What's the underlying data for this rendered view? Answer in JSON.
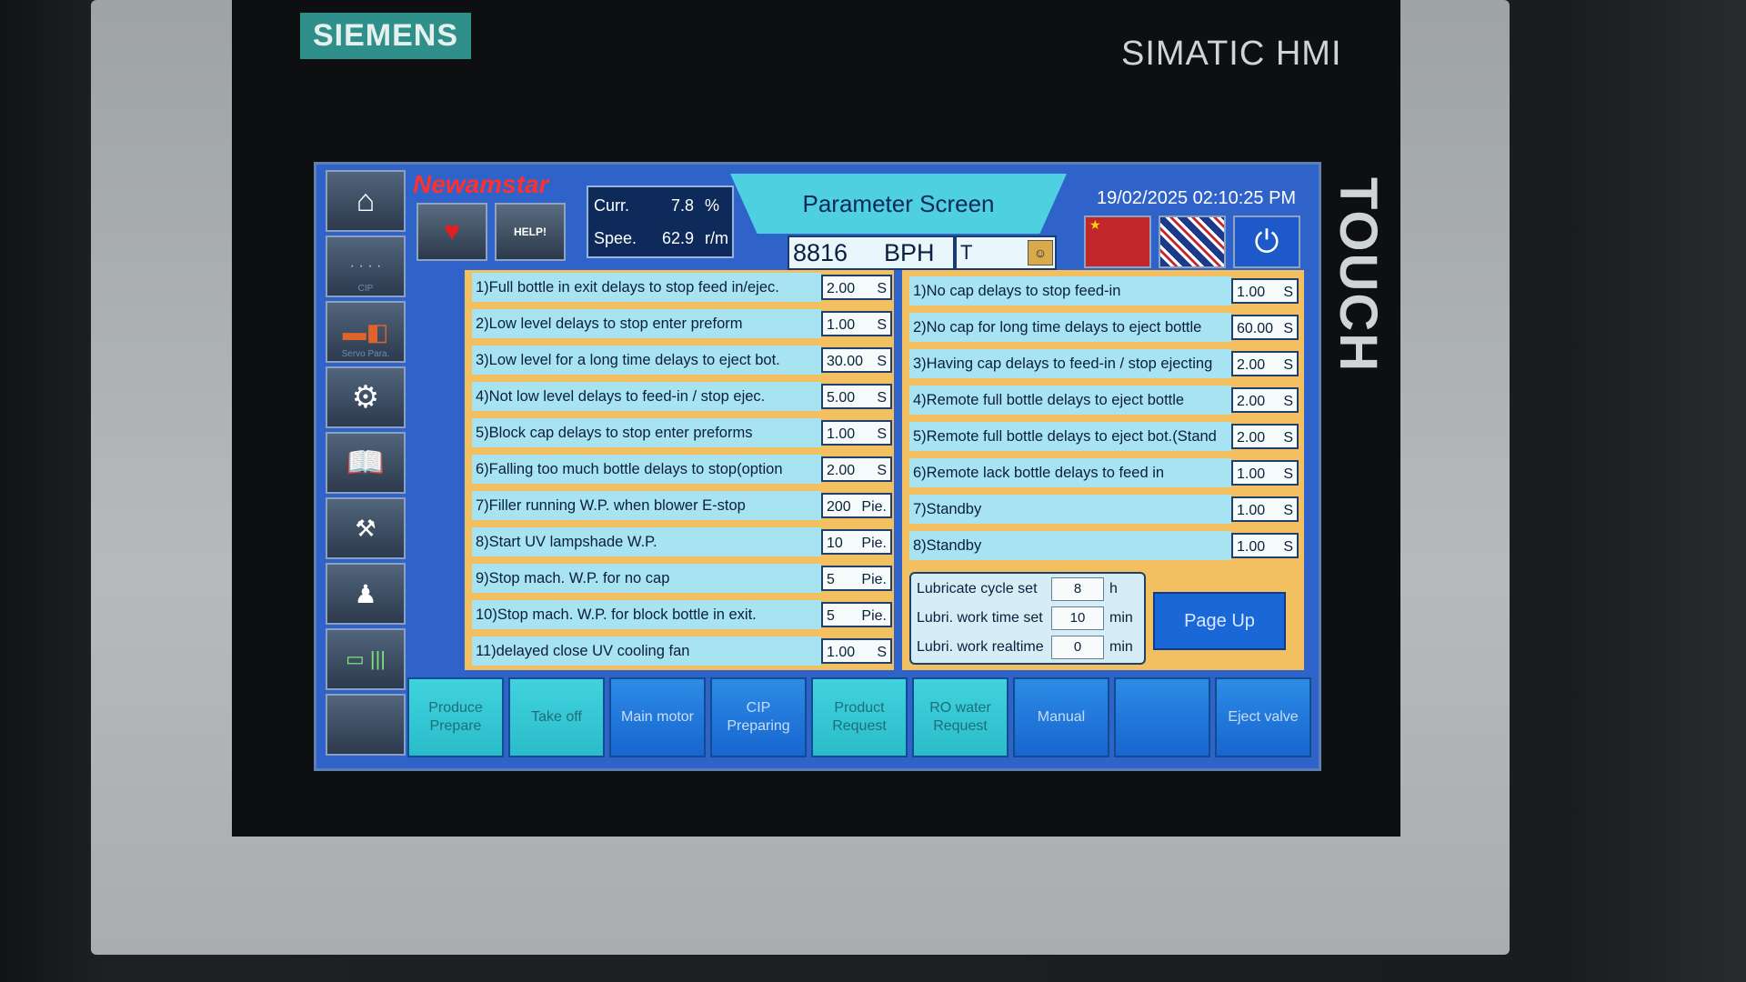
{
  "device": {
    "brand": "SIEMENS",
    "model": "SIMATIC HMI",
    "touch_label": "TOUCH"
  },
  "header": {
    "logo": "Newamstar",
    "help_label": "HELP!",
    "curr_label": "Curr.",
    "curr_value": "7.8",
    "curr_unit": "%",
    "speed_label": "Spee.",
    "speed_value": "62.9",
    "speed_unit": "r/m",
    "title": "Parameter Screen",
    "bph_value": "8816",
    "bph_unit": "BPH",
    "t_field": "T",
    "datetime": "19/02/2025 02:10:25 PM"
  },
  "sidebar": {
    "cip_caption": "CIP",
    "servo_caption": "Servo Para."
  },
  "left_params": [
    {
      "label": "1)Full bottle in exit delays to stop feed in/ejec.",
      "value": "2.00",
      "unit": "S"
    },
    {
      "label": "2)Low level delays to stop enter preform",
      "value": "1.00",
      "unit": "S"
    },
    {
      "label": "3)Low level for a long time delays to eject bot.",
      "value": "30.00",
      "unit": "S"
    },
    {
      "label": "4)Not low level delays to feed-in / stop ejec.",
      "value": "5.00",
      "unit": "S"
    },
    {
      "label": "5)Block cap delays to stop enter preforms",
      "value": "1.00",
      "unit": "S"
    },
    {
      "label": "6)Falling too much bottle delays to stop(option",
      "value": "2.00",
      "unit": "S"
    },
    {
      "label": "7)Filler running W.P. when blower E-stop",
      "value": "200",
      "unit": "Pie."
    },
    {
      "label": "8)Start UV lampshade W.P.",
      "value": "10",
      "unit": "Pie."
    },
    {
      "label": "9)Stop mach.  W.P. for no cap",
      "value": "5",
      "unit": "Pie."
    },
    {
      "label": "10)Stop mach. W.P. for block bottle in exit.",
      "value": "5",
      "unit": "Pie."
    },
    {
      "label": "11)delayed close UV cooling fan",
      "value": "1.00",
      "unit": "S"
    }
  ],
  "right_params": [
    {
      "label": "1)No cap delays to stop feed-in",
      "value": "1.00",
      "unit": "S"
    },
    {
      "label": "2)No cap for long time  delays to eject bottle",
      "value": "60.00",
      "unit": "S"
    },
    {
      "label": "3)Having cap delays to feed-in / stop ejecting",
      "value": "2.00",
      "unit": "S"
    },
    {
      "label": "4)Remote full bottle delays to eject bottle",
      "value": "2.00",
      "unit": "S"
    },
    {
      "label": "5)Remote full bottle delays to eject bot.(Stand",
      "value": "2.00",
      "unit": "S"
    },
    {
      "label": "6)Remote lack bottle delays to feed in",
      "value": "1.00",
      "unit": "S"
    },
    {
      "label": "7)Standby",
      "value": "1.00",
      "unit": "S"
    },
    {
      "label": "8)Standby",
      "value": "1.00",
      "unit": "S"
    }
  ],
  "lubrication": {
    "rows": [
      {
        "label": "Lubricate cycle set",
        "value": "8",
        "unit": "h"
      },
      {
        "label": "Lubri. work time set",
        "value": "10",
        "unit": "min"
      },
      {
        "label": "Lubri. work realtime",
        "value": "0",
        "unit": "min"
      }
    ]
  },
  "page_up_label": "Page Up",
  "bottom_buttons": [
    {
      "label": "Produce\nPrepare",
      "style": "cyan"
    },
    {
      "label": "Take off",
      "style": "cyan"
    },
    {
      "label": "Main motor",
      "style": "blue"
    },
    {
      "label": "CIP\nPreparing",
      "style": "blue"
    },
    {
      "label": "Product\nRequest",
      "style": "cyan"
    },
    {
      "label": "RO water\nRequest",
      "style": "cyan"
    },
    {
      "label": "Manual",
      "style": "blue"
    },
    {
      "label": "",
      "style": "blue"
    },
    {
      "label": "Eject valve",
      "style": "blue"
    }
  ],
  "colors": {
    "screen_bg": "#2f63c9",
    "panel_bg": "#f3c061",
    "param_label_bg": "#a8e3f2",
    "title_band": "#4fd0e0",
    "flag_red": "#c0262a"
  }
}
